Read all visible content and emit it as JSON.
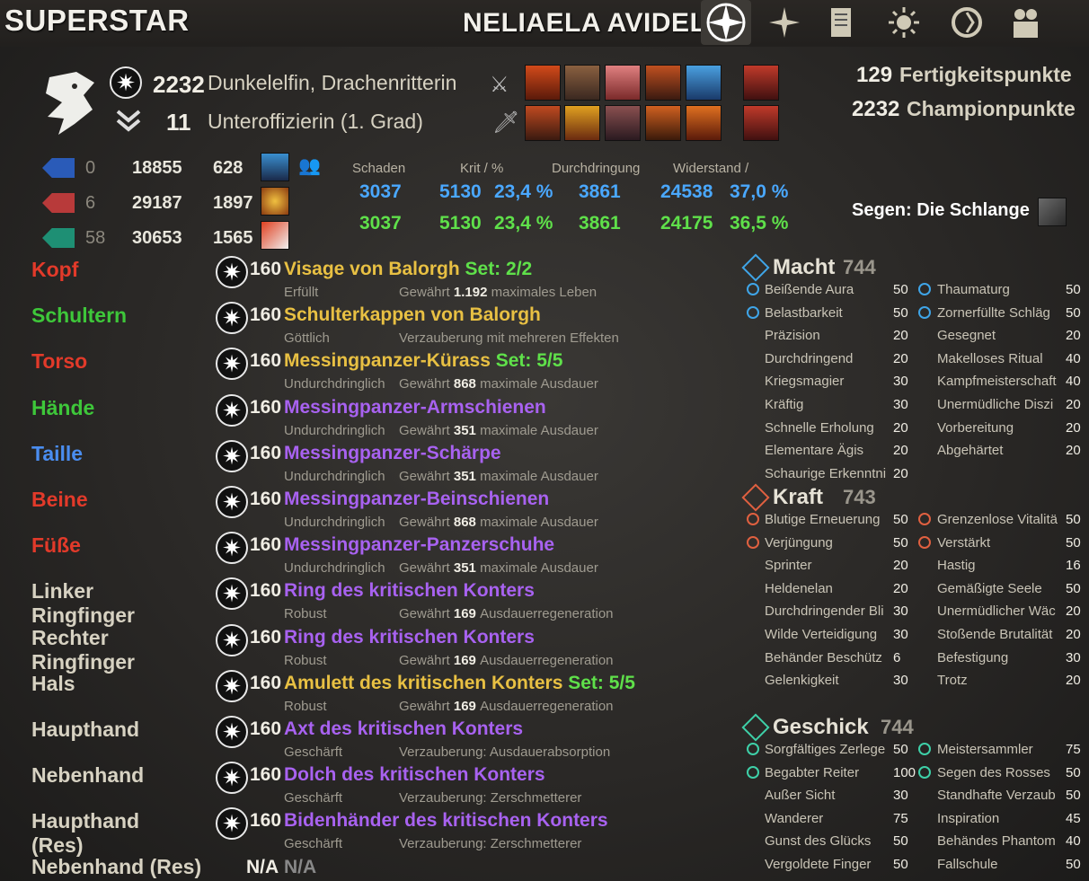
{
  "header": {
    "game_title": "SUPERSTAR",
    "character_name": "NELIAELA AVIDEL",
    "nav_icons": [
      "compass-icon",
      "stars-icon",
      "scroll-icon",
      "sun-icon",
      "cycle-icon",
      "group-icon"
    ]
  },
  "profile": {
    "champion_level": "2232",
    "race_class": "Dunkelelfin, Drachenritterin",
    "rank_number": "11",
    "rank_title": "Unteroffizierin (1. Grad)",
    "skill_points": "129",
    "skill_points_label": "Fertigkeitspunkte",
    "champion_points": "2232",
    "champion_points_label": "Championpunkte",
    "mundus": "Segen: Die Schlange"
  },
  "resources": [
    {
      "rank": "0",
      "max": "18855",
      "regen": "628",
      "color": "#2a5bb8"
    },
    {
      "rank": "6",
      "max": "29187",
      "regen": "1897",
      "color": "#b83a3a"
    },
    {
      "rank": "58",
      "max": "30653",
      "regen": "1565",
      "color": "#1e8f74"
    }
  ],
  "stats": {
    "headers": [
      "Schaden",
      "Krit / %",
      "Durchdringung",
      "Widerstand /"
    ],
    "row_blue": [
      "3037",
      "5130",
      "23,4 %",
      "3861",
      "24538",
      "37,0 %"
    ],
    "row_green": [
      "3037",
      "5130",
      "23,4 %",
      "3861",
      "24175",
      "36,5 %"
    ]
  },
  "equipment": [
    {
      "slot": "Kopf",
      "slot_color": "#e23a2a",
      "level": "160",
      "name": "Visage von Balorgh",
      "name_color": "#e8c043",
      "set": "Set: 2/2",
      "trait": "Erfüllt",
      "ench_pre": "Gewährt",
      "ench_val": "1.192",
      "ench_post": "maximales Leben"
    },
    {
      "slot": "Schultern",
      "slot_color": "#3ec73a",
      "level": "160",
      "name": "Schulterkappen von Balorgh",
      "name_color": "#e8c043",
      "set": "",
      "trait": "Göttlich",
      "ench_pre": "Verzauberung mit mehreren Effekten",
      "ench_val": "",
      "ench_post": ""
    },
    {
      "slot": "Torso",
      "slot_color": "#e23a2a",
      "level": "160",
      "name": "Messingpanzer-Kürass",
      "name_color": "#e8c043",
      "set": "Set: 5/5",
      "trait": "Undurchdringlich",
      "ench_pre": "Gewährt",
      "ench_val": "868",
      "ench_post": "maximale Ausdauer"
    },
    {
      "slot": "Hände",
      "slot_color": "#3ec73a",
      "level": "160",
      "name": "Messingpanzer-Armschienen",
      "name_color": "#a862f0",
      "set": "",
      "trait": "Undurchdringlich",
      "ench_pre": "Gewährt",
      "ench_val": "351",
      "ench_post": "maximale Ausdauer"
    },
    {
      "slot": "Taille",
      "slot_color": "#4a8df0",
      "level": "160",
      "name": "Messingpanzer-Schärpe",
      "name_color": "#a862f0",
      "set": "",
      "trait": "Undurchdringlich",
      "ench_pre": "Gewährt",
      "ench_val": "351",
      "ench_post": "maximale Ausdauer"
    },
    {
      "slot": "Beine",
      "slot_color": "#e23a2a",
      "level": "160",
      "name": "Messingpanzer-Beinschienen",
      "name_color": "#a862f0",
      "set": "",
      "trait": "Undurchdringlich",
      "ench_pre": "Gewährt",
      "ench_val": "868",
      "ench_post": "maximale Ausdauer"
    },
    {
      "slot": "Füße",
      "slot_color": "#e23a2a",
      "level": "160",
      "name": "Messingpanzer-Panzerschuhe",
      "name_color": "#a862f0",
      "set": "",
      "trait": "Undurchdringlich",
      "ench_pre": "Gewährt",
      "ench_val": "351",
      "ench_post": "maximale Ausdauer"
    },
    {
      "slot": "Linker Ringfinger",
      "slot_color": "#d7d2c2",
      "level": "160",
      "name": "Ring des kritischen Konters",
      "name_color": "#a862f0",
      "set": "",
      "trait": "Robust",
      "ench_pre": "Gewährt",
      "ench_val": "169",
      "ench_post": "Ausdauerregeneration"
    },
    {
      "slot": "Rechter Ringfinger",
      "slot_color": "#d7d2c2",
      "level": "160",
      "name": "Ring des kritischen Konters",
      "name_color": "#a862f0",
      "set": "",
      "trait": "Robust",
      "ench_pre": "Gewährt",
      "ench_val": "169",
      "ench_post": "Ausdauerregeneration"
    },
    {
      "slot": "Hals",
      "slot_color": "#d7d2c2",
      "level": "160",
      "name": "Amulett des kritischen Konters",
      "name_color": "#e8c043",
      "set": "Set: 5/5",
      "trait": "Robust",
      "ench_pre": "Gewährt",
      "ench_val": "169",
      "ench_post": "Ausdauerregeneration"
    },
    {
      "slot": "Haupthand",
      "slot_color": "#d7d2c2",
      "level": "160",
      "name": "Axt des kritischen Konters",
      "name_color": "#a862f0",
      "set": "",
      "trait": "Geschärft",
      "ench_pre": "Verzauberung: Ausdauerabsorption",
      "ench_val": "",
      "ench_post": ""
    },
    {
      "slot": "Nebenhand",
      "slot_color": "#d7d2c2",
      "level": "160",
      "name": "Dolch des kritischen Konters",
      "name_color": "#a862f0",
      "set": "",
      "trait": "Geschärft",
      "ench_pre": "Verzauberung: Zerschmetterer",
      "ench_val": "",
      "ench_post": ""
    },
    {
      "slot": "Haupthand (Res)",
      "slot_color": "#d7d2c2",
      "level": "160",
      "name": "Bidenhänder des kritischen Konters",
      "name_color": "#a862f0",
      "set": "",
      "trait": "Geschärft",
      "ench_pre": "Verzauberung: Zerschmetterer",
      "ench_val": "",
      "ench_post": ""
    }
  ],
  "offhand_res": {
    "slot": "Nebenhand (Res)",
    "na1": "N/A",
    "na2": "N/A"
  },
  "champion": [
    {
      "title": "Macht",
      "value": "744",
      "color": "#3fa5e8",
      "rows": [
        [
          "Beißende Aura",
          "50",
          "Thaumaturg",
          "50",
          true,
          true
        ],
        [
          "Belastbarkeit",
          "50",
          "Zornerfüllte Schläg",
          "50",
          true,
          true
        ],
        [
          "Präzision",
          "20",
          "Gesegnet",
          "20",
          false,
          false
        ],
        [
          "Durchdringend",
          "20",
          "Makelloses Ritual",
          "40",
          false,
          false
        ],
        [
          "Kriegsmagier",
          "30",
          "Kampfmeisterschaft",
          "40",
          false,
          false
        ],
        [
          "Kräftig",
          "30",
          "Unermüdliche Diszi",
          "20",
          false,
          false
        ],
        [
          "Schnelle Erholung",
          "20",
          "Vorbereitung",
          "20",
          false,
          false
        ],
        [
          "Elementare Ägis",
          "20",
          "Abgehärtet",
          "20",
          false,
          false
        ],
        [
          "Schaurige Erkenntni",
          "20",
          "",
          "",
          false,
          false
        ]
      ]
    },
    {
      "title": "Kraft",
      "value": "743",
      "color": "#e06040",
      "rows": [
        [
          "Blutige Erneuerung",
          "50",
          "Grenzenlose Vitalitä",
          "50",
          true,
          true
        ],
        [
          "Verjüngung",
          "50",
          "Verstärkt",
          "50",
          true,
          true
        ],
        [
          "Sprinter",
          "20",
          "Hastig",
          "16",
          false,
          false
        ],
        [
          "Heldenelan",
          "20",
          "Gemäßigte Seele",
          "50",
          false,
          false
        ],
        [
          "Durchdringender Bli",
          "30",
          "Unermüdlicher Wäc",
          "20",
          false,
          false
        ],
        [
          "Wilde Verteidigung",
          "30",
          "Stoßende Brutalität",
          "20",
          false,
          false
        ],
        [
          "Behänder Beschütz",
          "6",
          "Befestigung",
          "30",
          false,
          false
        ],
        [
          "Gelenkigkeit",
          "30",
          "Trotz",
          "20",
          false,
          false
        ]
      ]
    },
    {
      "title": "Geschick",
      "value": "744",
      "color": "#3ed0a8",
      "rows": [
        [
          "Sorgfältiges Zerlege",
          "50",
          "Meistersammler",
          "75",
          true,
          true
        ],
        [
          "Begabter Reiter",
          "100",
          "Segen des Rosses",
          "50",
          true,
          true
        ],
        [
          "Außer Sicht",
          "30",
          "Standhafte Verzaub",
          "50",
          false,
          false
        ],
        [
          "Wanderer",
          "75",
          "Inspiration",
          "45",
          false,
          false
        ],
        [
          "Gunst des Glücks",
          "50",
          "Behändes Phantom",
          "40",
          false,
          false
        ],
        [
          "Vergoldete Finger",
          "50",
          "Fallschule",
          "50",
          false,
          false
        ]
      ]
    }
  ]
}
